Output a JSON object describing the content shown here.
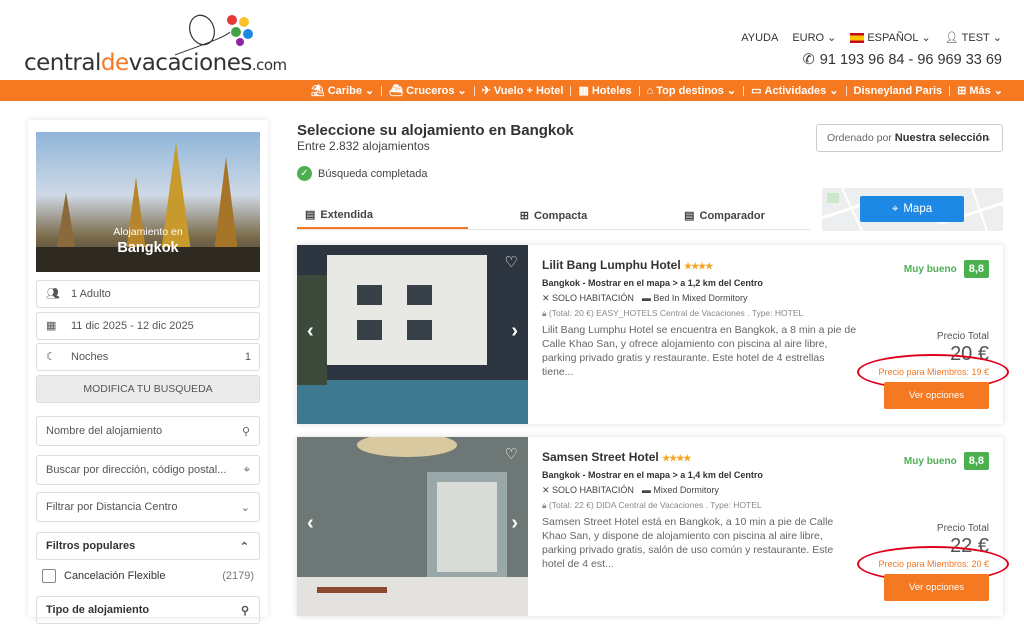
{
  "brand": {
    "logo_part1": "central",
    "logo_part2": "de",
    "logo_part3": "vacaciones",
    "logo_part4": ".com"
  },
  "topnav": {
    "help": "AYUDA",
    "currency": "EURO",
    "language": "ESPAÑOL",
    "user": "TEST",
    "phone": "91 193 96 84 - 96 969 33 69"
  },
  "menu": [
    {
      "label": "Caribe",
      "icon": "palm-icon"
    },
    {
      "label": "Cruceros",
      "icon": "ship-icon"
    },
    {
      "label": "Vuelo + Hotel",
      "icon": "plane-hotel-icon"
    },
    {
      "label": "Hoteles",
      "icon": "hotel-icon"
    },
    {
      "label": "Top destinos",
      "icon": "map-icon"
    },
    {
      "label": "Actividades",
      "icon": "ticket-icon"
    },
    {
      "label": "Disneyland Paris",
      "icon": ""
    },
    {
      "label": "Más",
      "icon": "plus-icon"
    }
  ],
  "sidebar": {
    "hero_line1": "Alojamiento en",
    "hero_line2": "Bangkok",
    "guests": "1 Adulto",
    "dates": "11 dic 2025 - 12 dic 2025",
    "nights_label": "Noches",
    "nights_value": "1",
    "modify_button": "MODIFICA TU BUSQUEDA",
    "name_placeholder": "Nombre del alojamiento",
    "address_placeholder": "Buscar por dirección, código postal...",
    "distance_filter": "Filtrar por Distancia Centro",
    "popular_filters": "Filtros populares",
    "flex_cancel_label": "Cancelación Flexible",
    "flex_cancel_count": "(2179)",
    "accommodation_type": "Tipo de alojamiento"
  },
  "results": {
    "title": "Seleccione su alojamiento en Bangkok",
    "subtitle": "Entre 2.832 alojamientos",
    "status": "Búsqueda completada",
    "sort_prefix": "Ordenado por",
    "sort_value": "Nuestra selección",
    "tabs": [
      "Extendida",
      "Compacta",
      "Comparador"
    ],
    "map_button": "Mapa"
  },
  "hotels": [
    {
      "name": "Lilit Bang Lumphu Hotel",
      "stars": "★★★★",
      "location": "Bangkok - Mostrar en el mapa > a 1,2 km del Centro",
      "regime": "SOLO HABITACIÓN",
      "room": "Bed In Mixed Dormitory",
      "provider": "(Total: 20 €) EASY_HOTELS Central de Vacaciones . Type: HOTEL",
      "description": "Lilit Bang Lumphu Hotel se encuentra en Bangkok, a 8 min a pie de Calle Khao San, y ofrece alojamiento con piscina al aire libre, parking privado gratis y restaurante. Este hotel de 4 estrellas tiene...",
      "rating_label": "Muy bueno",
      "rating_score": "8,8",
      "price_label": "Precio Total",
      "price": "20 €",
      "member_price": "Precio para Miembros: 19 €",
      "options_button": "Ver opciones"
    },
    {
      "name": "Samsen Street Hotel",
      "stars": "★★★★",
      "location": "Bangkok - Mostrar en el mapa > a 1,4 km del Centro",
      "regime": "SOLO HABITACIÓN",
      "room": "Mixed Dormitory",
      "provider": "(Total: 22 €) DIDA Central de Vacaciones . Type: HOTEL",
      "description": "Samsen Street Hotel está en Bangkok, a 10 min a pie de Calle Khao San, y dispone de alojamiento con piscina al aire libre, parking privado gratis, salón de uso común y restaurante. Este hotel de 4 est...",
      "rating_label": "Muy bueno",
      "rating_score": "8,8",
      "price_label": "Precio Total",
      "price": "22 €",
      "member_price": "Precio para Miembros: 20 €",
      "options_button": "Ver opciones"
    }
  ],
  "colors": {
    "brand_orange": "#f47920",
    "rating_green": "#4caf50",
    "map_blue": "#1e88e5",
    "highlight_red": "#e0001b"
  }
}
